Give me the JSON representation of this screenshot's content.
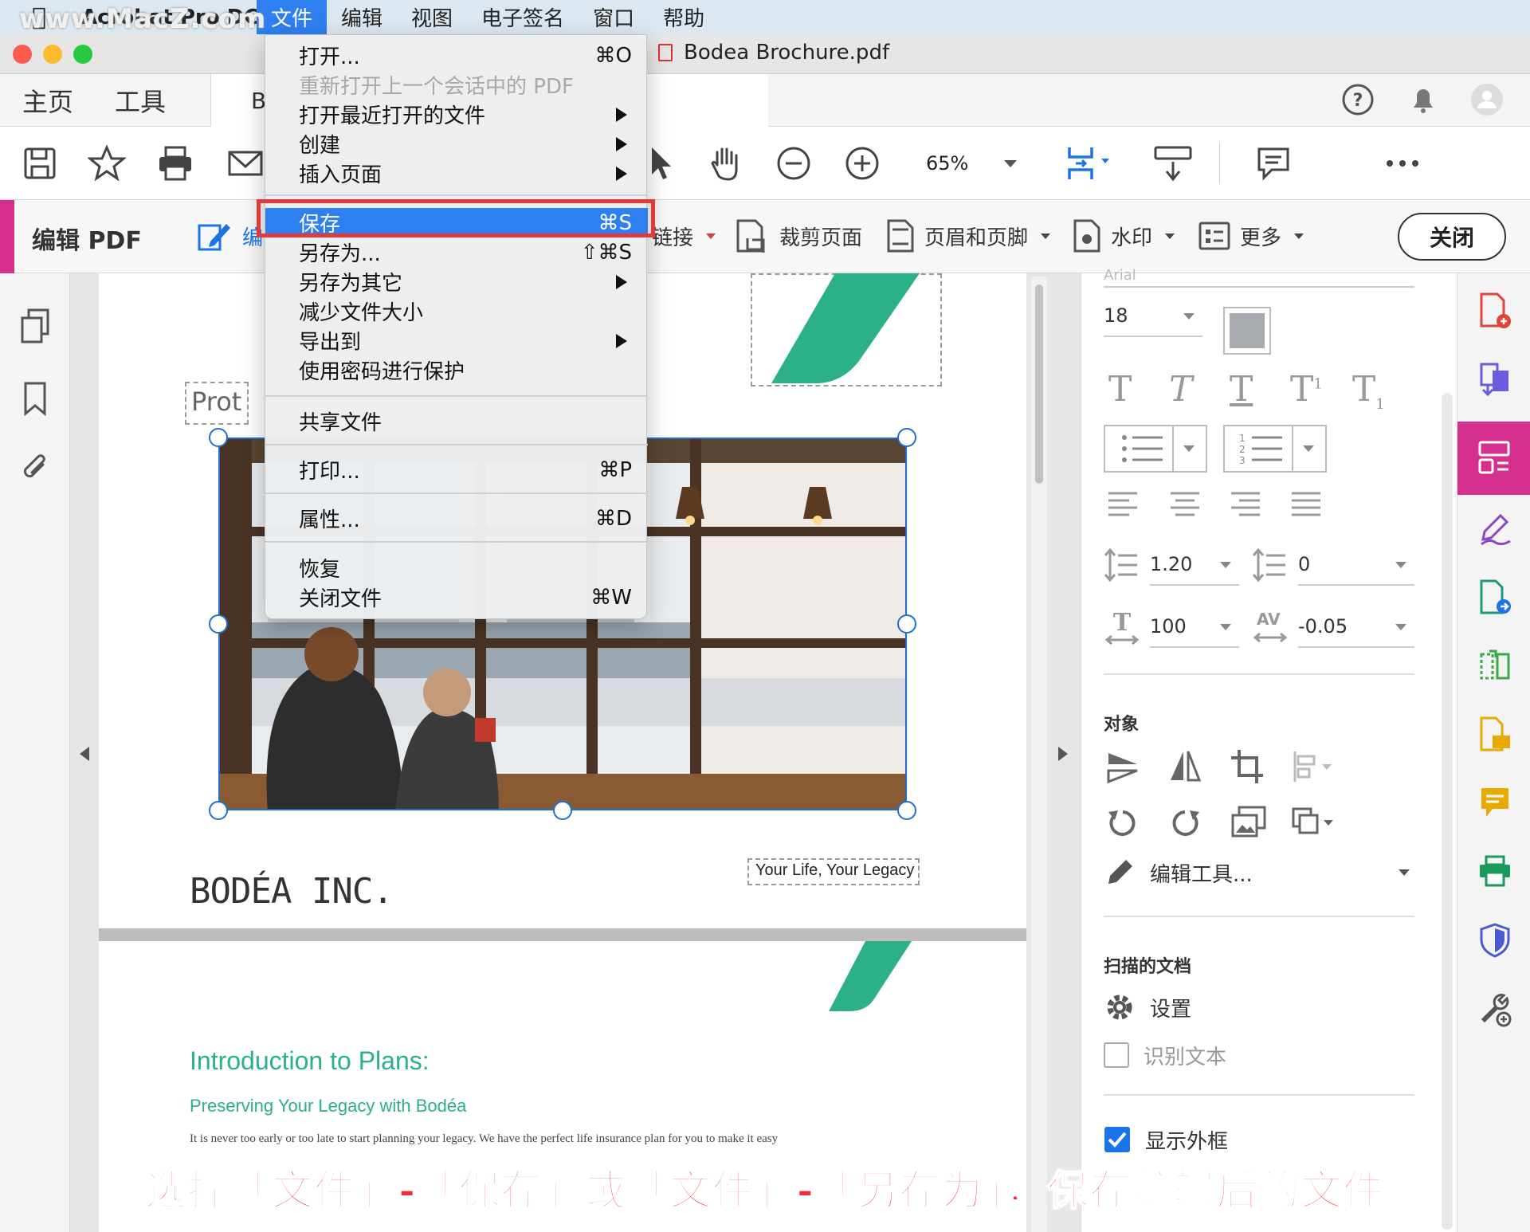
{
  "menubar": {
    "watermark": "www.MacZ.com",
    "app_name": "Acrobat Pro DC",
    "items": [
      "文件",
      "编辑",
      "视图",
      "电子签名",
      "窗口",
      "帮助"
    ]
  },
  "window": {
    "doc_title": "Bodea Brochure.pdf"
  },
  "nav": {
    "home": "主页",
    "tools": "工具",
    "doc_tab_initial": "B"
  },
  "toolbar": {
    "zoom": "65%"
  },
  "editbar": {
    "title": "编辑 PDF",
    "edit_partial": "编",
    "link": "链接",
    "crop": "裁剪页面",
    "header_footer": "页眉和页脚",
    "watermark": "水印",
    "more": "更多",
    "close": "关闭"
  },
  "file_menu": {
    "open": "打开...",
    "open_sc": "⌘O",
    "reopen": "重新打开上一个会话中的 PDF",
    "recent": "打开最近打开的文件",
    "create": "创建",
    "insert": "插入页面",
    "save": "保存",
    "save_sc": "⌘S",
    "save_as": "另存为...",
    "save_as_sc": "⇧⌘S",
    "save_other": "另存为其它",
    "reduce": "减少文件大小",
    "export": "导出到",
    "protect": "使用密码进行保护",
    "share": "共享文件",
    "print": "打印...",
    "print_sc": "⌘P",
    "props": "属性...",
    "props_sc": "⌘D",
    "revert": "恢复",
    "close": "关闭文件",
    "close_sc": "⌘W"
  },
  "page": {
    "prot_partial": "Prot",
    "tagline": "Your Life, Your Legacy",
    "logo": "BODÉA INC.",
    "intro_title": "Introduction to Plans:",
    "intro_sub": "Preserving Your Legacy with Bodéa",
    "body_line": "It is never too early or too late to start planning your legacy. We have the perfect life insurance plan for you to make it easy"
  },
  "rightpanel": {
    "font_partial": "Arial",
    "font_size": "18",
    "line_spacing": "1.20",
    "para_spacing": "0",
    "h_scale": "100",
    "char_spacing": "-0.05",
    "tracking_label": "AV",
    "objects_title": "对象",
    "edit_tools": "编辑工具...",
    "scanned_title": "扫描的文档",
    "settings": "设置",
    "ocr": "识别文本",
    "show_bbox": "显示外框"
  },
  "caption": "选择「文件」-「保存」或「文件」-「另存为」，保存编辑后的文件",
  "colors": {
    "accent_pink": "#d6308f",
    "menu_highlight": "#2e7ff0",
    "highlight_box": "#e23a3a",
    "brand_green": "#2bb08a",
    "caption_red": "#ef2c32"
  }
}
